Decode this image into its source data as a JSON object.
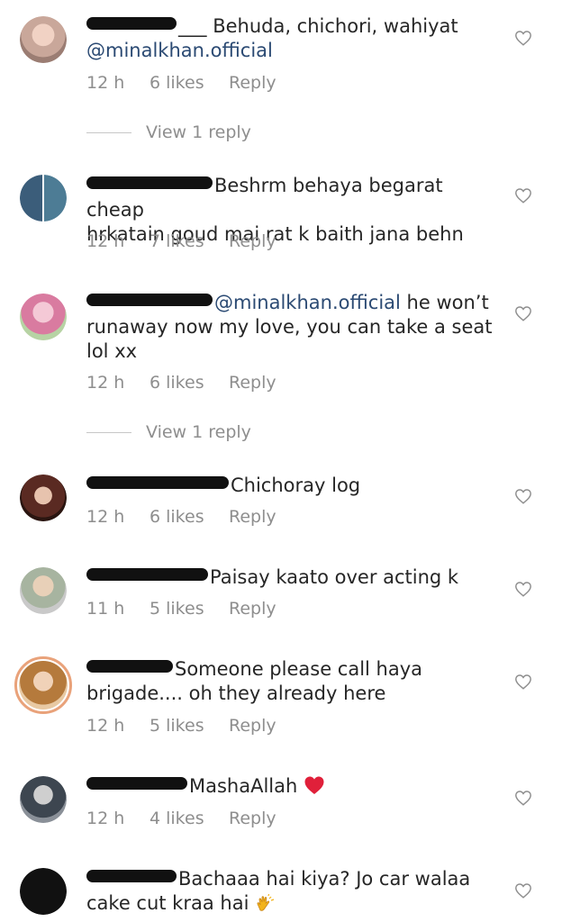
{
  "comments": [
    {
      "text": "Behuda, chichori, wahiyat",
      "mention": "@minalkhan.official",
      "time": "12 h",
      "likes": "6 likes",
      "reply_label": "Reply",
      "view_replies": "View 1 reply",
      "username_visible": "___"
    },
    {
      "text_line1": "Beshrm behaya begarat cheap",
      "text_line2": "hrkatain goud mai rat k baith jana behn",
      "time": "12 h",
      "likes": "7 likes",
      "reply_label": "Reply"
    },
    {
      "mention": "@minalkhan.official",
      "text_after_mention": " he won’t",
      "text_line2": "runaway now my love, you can take a seat",
      "text_line3": "lol xx",
      "time": "12 h",
      "likes": "6 likes",
      "reply_label": "Reply",
      "view_replies": "View 1 reply"
    },
    {
      "text": "Chichoray log",
      "time": "12 h",
      "likes": "6 likes",
      "reply_label": "Reply"
    },
    {
      "text": "Paisay kaato over acting k",
      "time": "11 h",
      "likes": "5 likes",
      "reply_label": "Reply"
    },
    {
      "text_line1": "Someone please call haya",
      "text_line2": "brigade.... oh they already here",
      "time": "12 h",
      "likes": "5 likes",
      "reply_label": "Reply"
    },
    {
      "text": "MashaAllah",
      "emoji": "red-heart",
      "time": "12 h",
      "likes": "4 likes",
      "reply_label": "Reply"
    },
    {
      "text_line1": "Bachaaa hai kiya? Jo car walaa",
      "text_line2": "cake cut kraa hai",
      "emoji": "clapping-hands"
    }
  ],
  "colors": {
    "text": "#262626",
    "meta": "#8e8e8e",
    "mention": "#2b4a73",
    "heart_outline": "#8e8e8e",
    "red_heart": "#e0203a",
    "redaction": "#111111"
  },
  "icons": {
    "like": "heart-outline-icon",
    "emoji_heart": "red-heart-icon",
    "emoji_clap": "clapping-hands-icon"
  }
}
